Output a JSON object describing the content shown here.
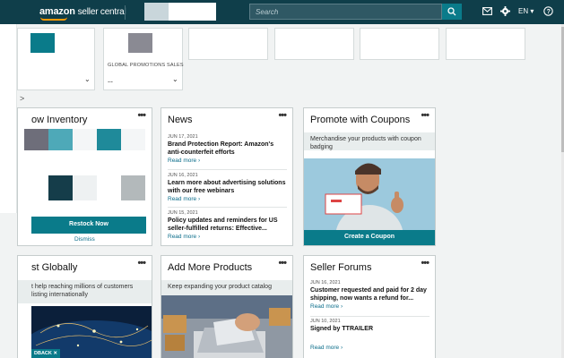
{
  "header": {
    "logo_brand": "amazon",
    "logo_suffix": "seller central",
    "search_placeholder": "Search",
    "language": "EN",
    "lang_caret": "▾"
  },
  "sidebar_chevrons": [
    ">",
    ">",
    ">",
    ">"
  ],
  "global_promotions": {
    "label": "GLOBAL PROMOTIONS SALES",
    "value": "--"
  },
  "inventory": {
    "title": "ow Inventory",
    "restock_label": "Restock Now",
    "dismiss_label": "Dismiss"
  },
  "news": {
    "title": "News",
    "items": [
      {
        "date": "JUN 17, 2021",
        "headline": "Brand Protection Report: Amazon's anti-counterfeit efforts",
        "link": "Read more ›"
      },
      {
        "date": "JUN 16, 2021",
        "headline": "Learn more about advertising solutions with our free webinars",
        "link": "Read more ›"
      },
      {
        "date": "JUN 15, 2021",
        "headline": "Policy updates and reminders for US seller-fulfilled returns: Effective...",
        "link": "Read more ›"
      }
    ]
  },
  "coupons": {
    "title": "Promote with Coupons",
    "subtitle": "Merchandise your products with coupon badging",
    "button_label": "Create a Coupon"
  },
  "sell_globally": {
    "title": "st Globally",
    "subtitle": "t help reaching millions of customers listing internationally",
    "feedback": "DBACK"
  },
  "add_products": {
    "title": "Add More Products",
    "subtitle": "Keep expanding your product catalog"
  },
  "forums": {
    "title": "Seller Forums",
    "items": [
      {
        "date": "JUN 16, 2021",
        "headline": "Customer requested and paid for 2 day shipping, now wants a refund for...",
        "link": "Read more ›"
      },
      {
        "date": "JUN 10, 2021",
        "headline": "Signed by TTRAILER",
        "link": ""
      }
    ],
    "final_link": "Read more ›"
  },
  "more_dots": "•••",
  "colors": {
    "topbar": "#0f3e4a",
    "teal_button": "#0a7b8a",
    "link": "#0b6d8a",
    "logo_accent": "#ff9900"
  }
}
